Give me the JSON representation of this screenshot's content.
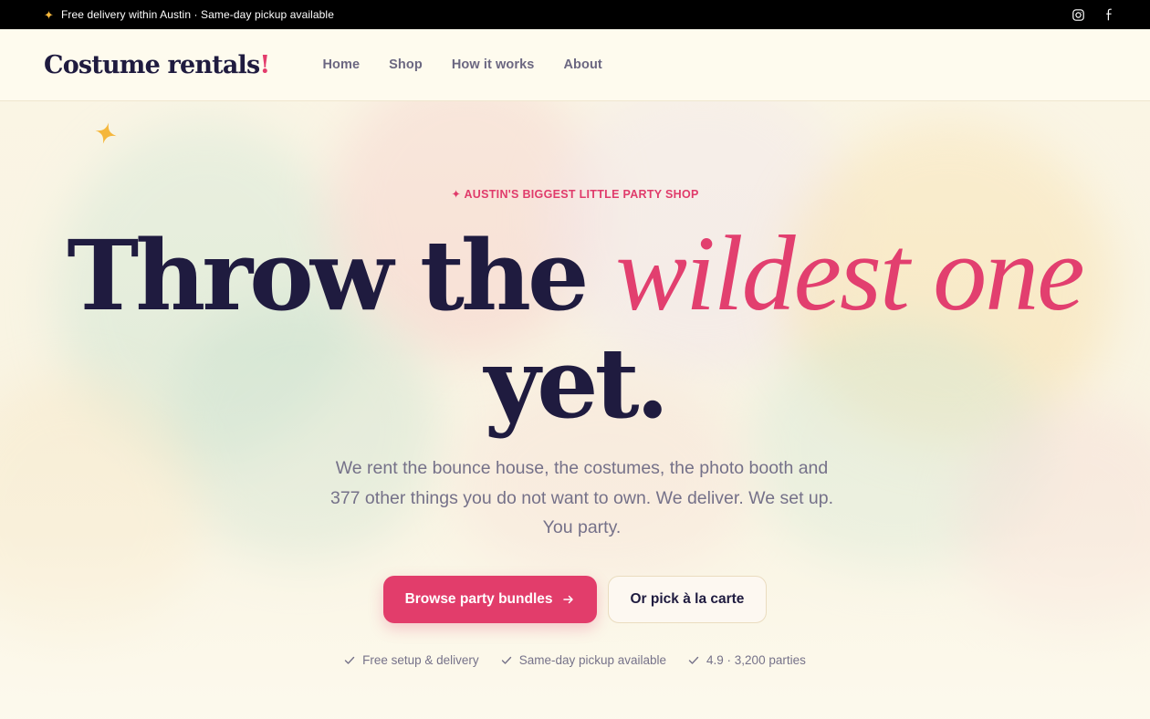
{
  "topbar": {
    "message": "Free delivery within Austin · Same-day pickup available",
    "icons": [
      "sparkle-icon",
      "instagram-icon",
      "facebook-icon"
    ]
  },
  "header": {
    "logo_text": "Costume rentals",
    "logo_mark": "!",
    "nav": [
      {
        "label": "Home"
      },
      {
        "label": "Shop"
      },
      {
        "label": "How it works"
      },
      {
        "label": "About"
      }
    ]
  },
  "hero": {
    "eyebrow": "✦ AUSTIN'S BIGGEST LITTLE PARTY SHOP",
    "headline_part1": "Throw the ",
    "headline_accent": "wildest one",
    "headline_part2": "yet.",
    "subcopy": "We rent the bounce house, the costumes, the photo booth and 377 other things you do not want to own. We deliver. We set up. You party.",
    "primary_cta": "Browse party bundles",
    "primary_cta_icon": "arrow-right-icon",
    "secondary_cta": "Or pick à la carte",
    "trust": [
      {
        "label": "Free setup & delivery",
        "icon": "check-icon"
      },
      {
        "label": "Same-day pickup available",
        "icon": "check-icon"
      },
      {
        "label": "4.9 · 3,200 parties",
        "icon": "check-icon"
      }
    ]
  },
  "colors": {
    "accent": "#e23d6b",
    "ink": "#1f1b3f",
    "muted": "#757189",
    "cream": "#fdf9ec",
    "star": "#f5b73c"
  }
}
